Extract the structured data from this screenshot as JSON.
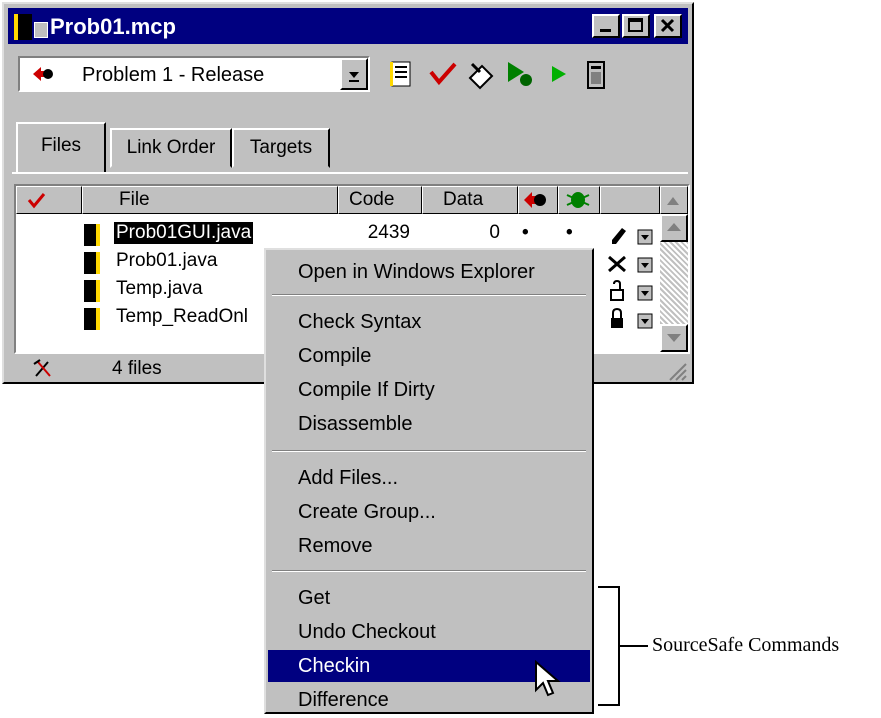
{
  "window": {
    "title": "Prob01.mcp"
  },
  "target": {
    "selected": "Problem 1 - Release"
  },
  "tabs": [
    {
      "label": "Files"
    },
    {
      "label": "Link Order"
    },
    {
      "label": "Targets"
    }
  ],
  "columns": {
    "file": "File",
    "code": "Code",
    "data": "Data"
  },
  "files": [
    {
      "name": "Prob01GUI.java",
      "code": "2439",
      "data": "0",
      "dot1": "•",
      "dot2": "•"
    },
    {
      "name": "Prob01.java"
    },
    {
      "name": "Temp.java"
    },
    {
      "name": "Temp_ReadOnl"
    }
  ],
  "status": {
    "count": "4 files"
  },
  "menu": {
    "open_explorer": "Open in Windows Explorer",
    "check_syntax": "Check Syntax",
    "compile": "Compile",
    "compile_if_dirty": "Compile If Dirty",
    "disassemble": "Disassemble",
    "add_files": "Add Files...",
    "create_group": "Create Group...",
    "remove": "Remove",
    "get": "Get",
    "undo_checkout": "Undo Checkout",
    "checkin": "Checkin",
    "difference": "Difference"
  },
  "annotation": {
    "label": "SourceSafe Commands"
  },
  "colors": {
    "titlebar": "#000080",
    "highlight": "#000080",
    "face": "#c0c0c0"
  }
}
